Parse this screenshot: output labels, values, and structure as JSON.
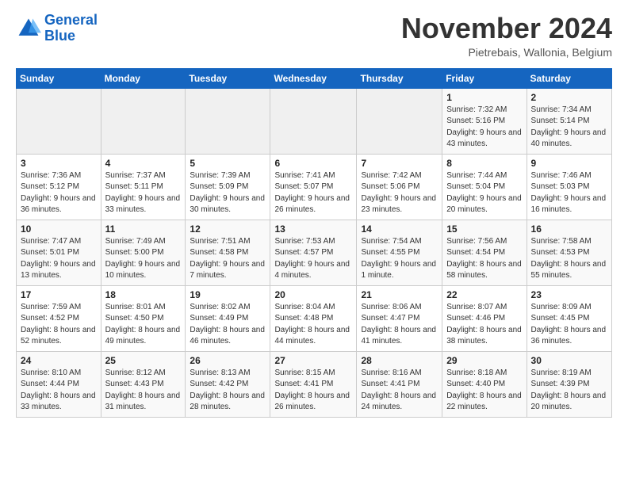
{
  "logo": {
    "line1": "General",
    "line2": "Blue"
  },
  "title": "November 2024",
  "subtitle": "Pietrebais, Wallonia, Belgium",
  "days_of_week": [
    "Sunday",
    "Monday",
    "Tuesday",
    "Wednesday",
    "Thursday",
    "Friday",
    "Saturday"
  ],
  "weeks": [
    [
      {
        "day": "",
        "info": ""
      },
      {
        "day": "",
        "info": ""
      },
      {
        "day": "",
        "info": ""
      },
      {
        "day": "",
        "info": ""
      },
      {
        "day": "",
        "info": ""
      },
      {
        "day": "1",
        "info": "Sunrise: 7:32 AM\nSunset: 5:16 PM\nDaylight: 9 hours and 43 minutes."
      },
      {
        "day": "2",
        "info": "Sunrise: 7:34 AM\nSunset: 5:14 PM\nDaylight: 9 hours and 40 minutes."
      }
    ],
    [
      {
        "day": "3",
        "info": "Sunrise: 7:36 AM\nSunset: 5:12 PM\nDaylight: 9 hours and 36 minutes."
      },
      {
        "day": "4",
        "info": "Sunrise: 7:37 AM\nSunset: 5:11 PM\nDaylight: 9 hours and 33 minutes."
      },
      {
        "day": "5",
        "info": "Sunrise: 7:39 AM\nSunset: 5:09 PM\nDaylight: 9 hours and 30 minutes."
      },
      {
        "day": "6",
        "info": "Sunrise: 7:41 AM\nSunset: 5:07 PM\nDaylight: 9 hours and 26 minutes."
      },
      {
        "day": "7",
        "info": "Sunrise: 7:42 AM\nSunset: 5:06 PM\nDaylight: 9 hours and 23 minutes."
      },
      {
        "day": "8",
        "info": "Sunrise: 7:44 AM\nSunset: 5:04 PM\nDaylight: 9 hours and 20 minutes."
      },
      {
        "day": "9",
        "info": "Sunrise: 7:46 AM\nSunset: 5:03 PM\nDaylight: 9 hours and 16 minutes."
      }
    ],
    [
      {
        "day": "10",
        "info": "Sunrise: 7:47 AM\nSunset: 5:01 PM\nDaylight: 9 hours and 13 minutes."
      },
      {
        "day": "11",
        "info": "Sunrise: 7:49 AM\nSunset: 5:00 PM\nDaylight: 9 hours and 10 minutes."
      },
      {
        "day": "12",
        "info": "Sunrise: 7:51 AM\nSunset: 4:58 PM\nDaylight: 9 hours and 7 minutes."
      },
      {
        "day": "13",
        "info": "Sunrise: 7:53 AM\nSunset: 4:57 PM\nDaylight: 9 hours and 4 minutes."
      },
      {
        "day": "14",
        "info": "Sunrise: 7:54 AM\nSunset: 4:55 PM\nDaylight: 9 hours and 1 minute."
      },
      {
        "day": "15",
        "info": "Sunrise: 7:56 AM\nSunset: 4:54 PM\nDaylight: 8 hours and 58 minutes."
      },
      {
        "day": "16",
        "info": "Sunrise: 7:58 AM\nSunset: 4:53 PM\nDaylight: 8 hours and 55 minutes."
      }
    ],
    [
      {
        "day": "17",
        "info": "Sunrise: 7:59 AM\nSunset: 4:52 PM\nDaylight: 8 hours and 52 minutes."
      },
      {
        "day": "18",
        "info": "Sunrise: 8:01 AM\nSunset: 4:50 PM\nDaylight: 8 hours and 49 minutes."
      },
      {
        "day": "19",
        "info": "Sunrise: 8:02 AM\nSunset: 4:49 PM\nDaylight: 8 hours and 46 minutes."
      },
      {
        "day": "20",
        "info": "Sunrise: 8:04 AM\nSunset: 4:48 PM\nDaylight: 8 hours and 44 minutes."
      },
      {
        "day": "21",
        "info": "Sunrise: 8:06 AM\nSunset: 4:47 PM\nDaylight: 8 hours and 41 minutes."
      },
      {
        "day": "22",
        "info": "Sunrise: 8:07 AM\nSunset: 4:46 PM\nDaylight: 8 hours and 38 minutes."
      },
      {
        "day": "23",
        "info": "Sunrise: 8:09 AM\nSunset: 4:45 PM\nDaylight: 8 hours and 36 minutes."
      }
    ],
    [
      {
        "day": "24",
        "info": "Sunrise: 8:10 AM\nSunset: 4:44 PM\nDaylight: 8 hours and 33 minutes."
      },
      {
        "day": "25",
        "info": "Sunrise: 8:12 AM\nSunset: 4:43 PM\nDaylight: 8 hours and 31 minutes."
      },
      {
        "day": "26",
        "info": "Sunrise: 8:13 AM\nSunset: 4:42 PM\nDaylight: 8 hours and 28 minutes."
      },
      {
        "day": "27",
        "info": "Sunrise: 8:15 AM\nSunset: 4:41 PM\nDaylight: 8 hours and 26 minutes."
      },
      {
        "day": "28",
        "info": "Sunrise: 8:16 AM\nSunset: 4:41 PM\nDaylight: 8 hours and 24 minutes."
      },
      {
        "day": "29",
        "info": "Sunrise: 8:18 AM\nSunset: 4:40 PM\nDaylight: 8 hours and 22 minutes."
      },
      {
        "day": "30",
        "info": "Sunrise: 8:19 AM\nSunset: 4:39 PM\nDaylight: 8 hours and 20 minutes."
      }
    ]
  ]
}
